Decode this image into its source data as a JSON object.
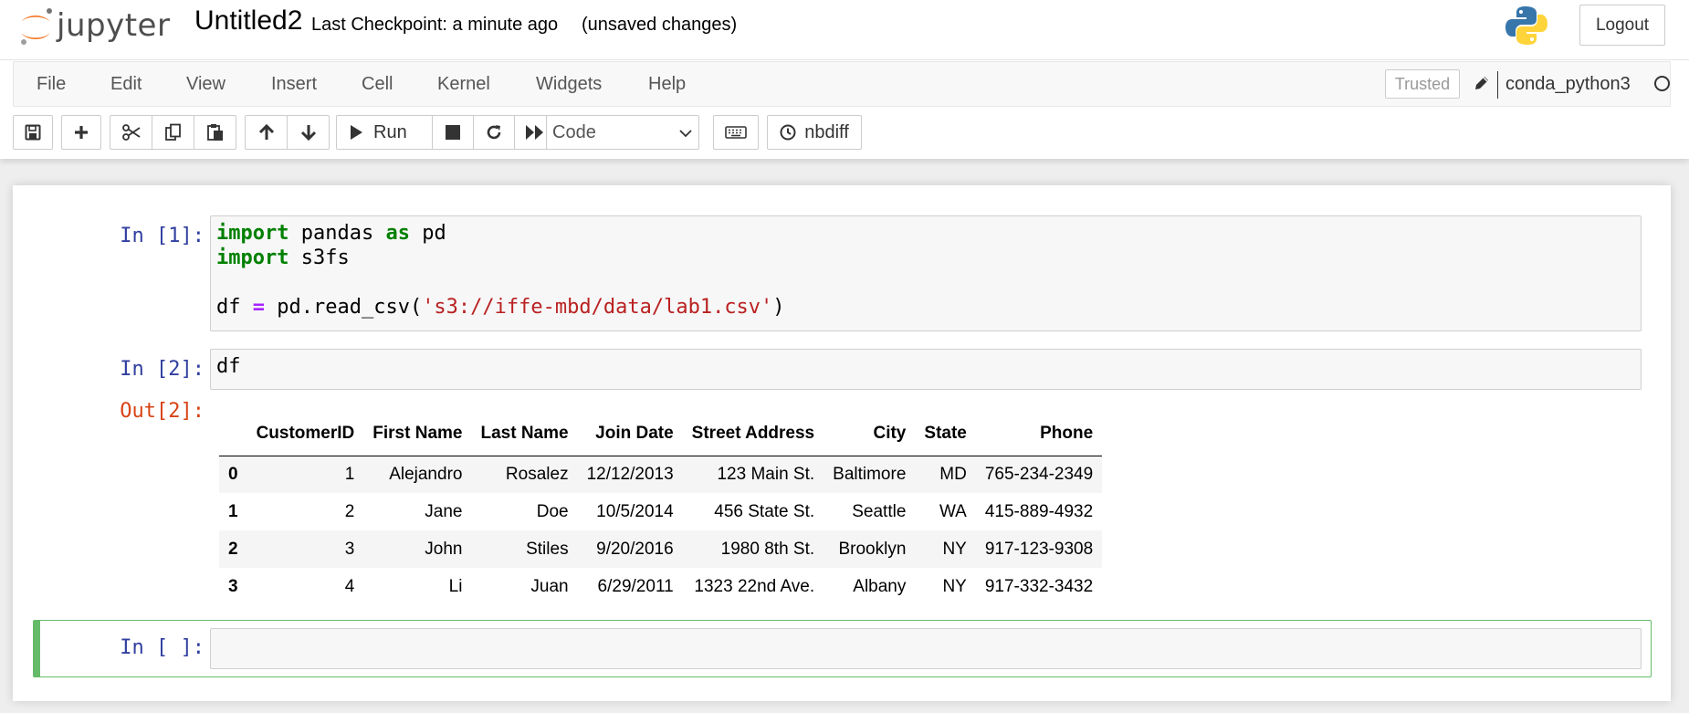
{
  "header": {
    "logo_text": "jupyter",
    "notebook_title": "Untitled2",
    "checkpoint": "Last Checkpoint: a minute ago",
    "autosave_status": "(unsaved changes)",
    "logout_label": "Logout"
  },
  "menubar": {
    "items": [
      "File",
      "Edit",
      "View",
      "Insert",
      "Cell",
      "Kernel",
      "Widgets",
      "Help"
    ],
    "trusted_label": "Trusted",
    "kernel_name": "conda_python3"
  },
  "toolbar": {
    "run_label": "Run",
    "cell_type": "Code",
    "nbdiff_label": "nbdiff",
    "icons": [
      "save-icon",
      "plus-icon",
      "scissors-icon",
      "copy-icon",
      "paste-icon",
      "arrow-up-icon",
      "arrow-down-icon",
      "play-icon",
      "stop-icon",
      "restart-icon",
      "fast-forward-icon",
      "keyboard-icon",
      "clock-icon"
    ]
  },
  "cells": {
    "c1": {
      "prompt": "In [1]:",
      "line1_kw": "import",
      "line1_a": " pandas ",
      "line1_kw2": "as",
      "line1_b": " pd",
      "line2_kw": "import",
      "line2_a": " s3fs",
      "line4_a": "df ",
      "line4_op": "=",
      "line4_b": " pd.read_csv(",
      "line4_str": "'s3://iffe-mbd/data/lab1.csv'",
      "line4_c": ")"
    },
    "c2": {
      "prompt": "In [2]:",
      "code": "df",
      "out_prompt": "Out[2]:"
    },
    "c3": {
      "prompt": "In [ ]:"
    }
  },
  "dataframe": {
    "columns": [
      "CustomerID",
      "First Name",
      "Last Name",
      "Join Date",
      "Street Address",
      "City",
      "State",
      "Phone"
    ],
    "rows": [
      {
        "index": "0",
        "cells": [
          "1",
          "Alejandro",
          "Rosalez",
          "12/12/2013",
          "123 Main St.",
          "Baltimore",
          "MD",
          "765-234-2349"
        ]
      },
      {
        "index": "1",
        "cells": [
          "2",
          "Jane",
          "Doe",
          "10/5/2014",
          "456 State St.",
          "Seattle",
          "WA",
          "415-889-4932"
        ]
      },
      {
        "index": "2",
        "cells": [
          "3",
          "John",
          "Stiles",
          "9/20/2016",
          "1980 8th St.",
          "Brooklyn",
          "NY",
          "917-123-9308"
        ]
      },
      {
        "index": "3",
        "cells": [
          "4",
          "Li",
          "Juan",
          "6/29/2011",
          "1323 22nd Ave.",
          "Albany",
          "NY",
          "917-332-3432"
        ]
      }
    ]
  },
  "colors": {
    "logo_orange": "#f37726",
    "prompt_in": "#303f9f",
    "prompt_out": "#d84315",
    "selected_border": "#66bb6a"
  }
}
